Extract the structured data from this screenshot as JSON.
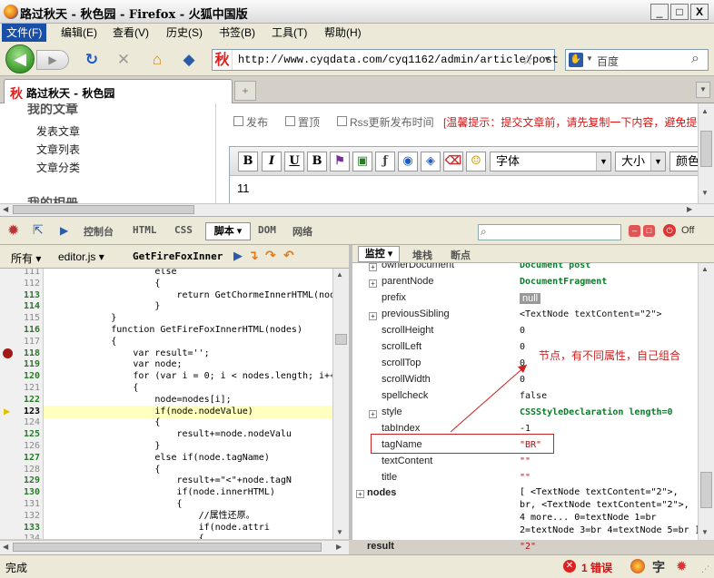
{
  "window": {
    "title": "路过秋天 - 秋色园 - Firefox - 火狐中国版",
    "min": "_",
    "max": "□",
    "close": "X"
  },
  "menubar": {
    "items": [
      "文件(F)",
      "编辑(E)",
      "查看(V)",
      "历史(S)",
      "书签(B)",
      "工具(T)",
      "帮助(H)"
    ]
  },
  "nav": {
    "url": "http://www.cyqdata.com/cyq1162/admin/article/post",
    "favicon": "秋",
    "search_placeholder": "百度",
    "back": "◀",
    "forward": "▶",
    "reload": "↻",
    "stop": "✕",
    "home": "⌂",
    "addon": "◆"
  },
  "tabs": {
    "active": "路过秋天 - 秋色园",
    "new_tab": "+"
  },
  "page": {
    "left_heading": "我的文章",
    "left_items": [
      "发表文章",
      "文章列表",
      "文章分类"
    ],
    "left_heading2": "我的相册",
    "options": [
      "发布",
      "置顶",
      "Rss更新发布时间"
    ],
    "notice": "[温馨提示：提交文章前，请先复制一下内容，避免提",
    "editor_buttons": [
      "B",
      "I",
      "U",
      "B",
      "⚑",
      "▣",
      "ƒ",
      "◉",
      "◈",
      "⌫",
      "☺"
    ],
    "font_select": "字体",
    "size_select": "大小",
    "color_select": "颜色",
    "editor_content": "11"
  },
  "firebug": {
    "tabs": [
      "控制台",
      "HTML",
      "CSS",
      "脚本",
      "DOM",
      "网络"
    ],
    "active_tab": "脚本",
    "off_label": "Off",
    "src_toolbar": {
      "all": "所有",
      "file": "editor.js",
      "function": "GetFireFoxInner"
    },
    "watch_tabs": [
      "监控",
      "堆栈",
      "断点"
    ],
    "lines": [
      {
        "n": "111",
        "code": "                    else"
      },
      {
        "n": "112",
        "code": "                    {"
      },
      {
        "n": "113",
        "code": "                        return GetChormeInnerHTML(nod"
      },
      {
        "n": "114",
        "code": "                    }"
      },
      {
        "n": "115",
        "code": "            }"
      },
      {
        "n": "116",
        "code": "            function GetFireFoxInnerHTML(nodes)"
      },
      {
        "n": "117",
        "code": "            {"
      },
      {
        "n": "118",
        "code": "                var result='';"
      },
      {
        "n": "119",
        "code": "                var node;"
      },
      {
        "n": "120",
        "code": "                for (var i = 0; i < nodes.length; i++"
      },
      {
        "n": "121",
        "code": "                {"
      },
      {
        "n": "122",
        "code": "                    node=nodes[i];"
      },
      {
        "n": "123",
        "code": "                    if(node.nodeValue)"
      },
      {
        "n": "124",
        "code": "                    {"
      },
      {
        "n": "125",
        "code": "                        result+=node.nodeValu"
      },
      {
        "n": "126",
        "code": "                    }"
      },
      {
        "n": "127",
        "code": "                    else if(node.tagName)"
      },
      {
        "n": "128",
        "code": "                    {"
      },
      {
        "n": "129",
        "code": "                        result+=\"<\"+node.tagN"
      },
      {
        "n": "130",
        "code": "                        if(node.innerHTML)"
      },
      {
        "n": "131",
        "code": "                        {"
      },
      {
        "n": "132",
        "code": "                            //属性还原。"
      },
      {
        "n": "133",
        "code": "                            if(node.attri"
      },
      {
        "n": "134",
        "code": "                            {"
      }
    ],
    "watch": [
      {
        "k": "ownerDocument",
        "v": "Document post",
        "exp": true,
        "vstyle": "g"
      },
      {
        "k": "parentNode",
        "v": "DocumentFragment",
        "exp": true,
        "vstyle": "g"
      },
      {
        "k": "prefix",
        "v": "null",
        "exp": false,
        "vstyle": "null"
      },
      {
        "k": "previousSibling",
        "v": "<TextNode textContent=\"2\">",
        "exp": true,
        "vstyle": "b"
      },
      {
        "k": "scrollHeight",
        "v": "0",
        "exp": false,
        "vstyle": "b"
      },
      {
        "k": "scrollLeft",
        "v": "0",
        "exp": false,
        "vstyle": "b"
      },
      {
        "k": "scrollTop",
        "v": "0",
        "exp": false,
        "vstyle": "b"
      },
      {
        "k": "scrollWidth",
        "v": "0",
        "exp": false,
        "vstyle": "b"
      },
      {
        "k": "spellcheck",
        "v": "false",
        "exp": false,
        "vstyle": "b"
      },
      {
        "k": "style",
        "v": "CSSStyleDeclaration length=0",
        "exp": true,
        "vstyle": "g"
      },
      {
        "k": "tabIndex",
        "v": "-1",
        "exp": false,
        "vstyle": "b"
      },
      {
        "k": "tagName",
        "v": "\"BR\"",
        "exp": false,
        "vstyle": "r"
      },
      {
        "k": "textContent",
        "v": "\"\"",
        "exp": false,
        "vstyle": "r"
      },
      {
        "k": "title",
        "v": "\"\"",
        "exp": false,
        "vstyle": "r"
      }
    ],
    "nodes_key": "nodes",
    "nodes_value": [
      "[ <TextNode textContent=\"2\">,",
      "br, <TextNode textContent=\"2\">,",
      "4 more... 0=textNode 1=br",
      "2=textNode 3=br 4=textNode 5=br ]"
    ],
    "result_key": "result",
    "result_value": "\"2\"",
    "annotation": "节点，有不同属性，自己组合"
  },
  "status": {
    "text": "完成",
    "errors": "1 错误",
    "zi": "字"
  },
  "colors": {
    "accent": "#1a4fa8",
    "annotation": "#cc2222",
    "watch_green": "#0b7a2a",
    "watch_red": "#a11"
  }
}
